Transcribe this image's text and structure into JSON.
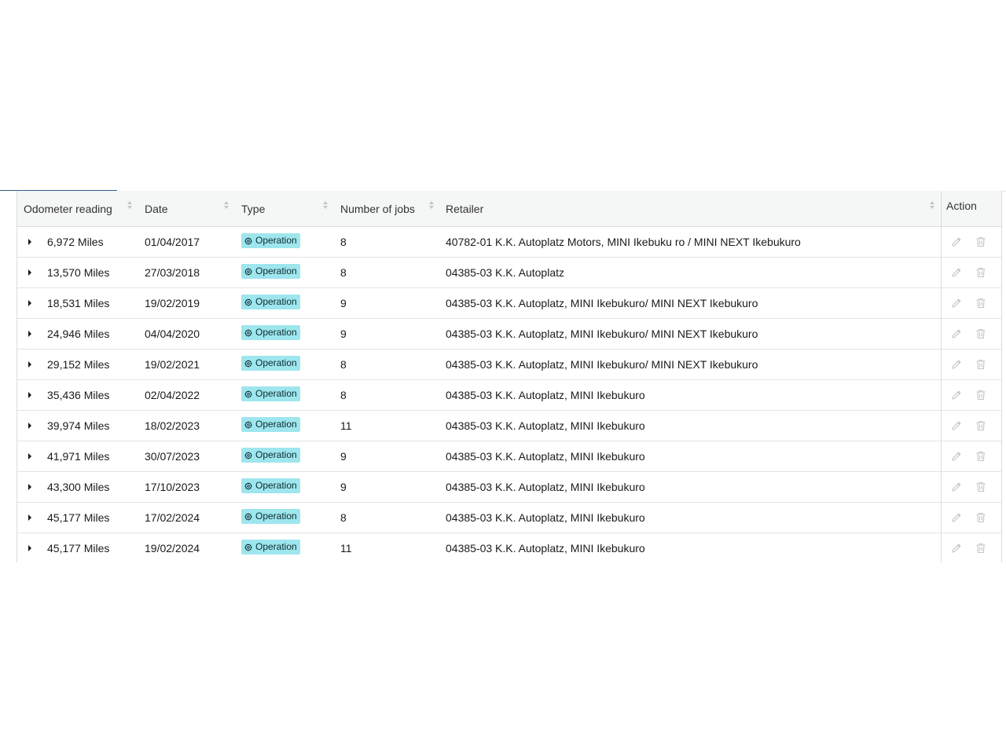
{
  "table": {
    "columns": {
      "odometer": "Odometer reading",
      "date": "Date",
      "type": "Type",
      "jobs": "Number of jobs",
      "retailer": "Retailer",
      "action": "Action"
    },
    "rows": [
      {
        "odometer": "6,972 Miles",
        "date": "01/04/2017",
        "type": "Operation",
        "jobs": "8",
        "retailer": "40782-01 K.K. Autoplatz Motors, MINI Ikebuku ro / MINI NEXT Ikebukuro"
      },
      {
        "odometer": "13,570 Miles",
        "date": "27/03/2018",
        "type": "Operation",
        "jobs": "8",
        "retailer": "04385-03 K.K. Autoplatz"
      },
      {
        "odometer": "18,531 Miles",
        "date": "19/02/2019",
        "type": "Operation",
        "jobs": "9",
        "retailer": "04385-03 K.K. Autoplatz, MINI Ikebukuro/ MINI NEXT Ikebukuro"
      },
      {
        "odometer": "24,946 Miles",
        "date": "04/04/2020",
        "type": "Operation",
        "jobs": "9",
        "retailer": "04385-03 K.K. Autoplatz, MINI Ikebukuro/ MINI NEXT Ikebukuro"
      },
      {
        "odometer": "29,152 Miles",
        "date": "19/02/2021",
        "type": "Operation",
        "jobs": "8",
        "retailer": "04385-03 K.K. Autoplatz, MINI Ikebukuro/ MINI NEXT Ikebukuro"
      },
      {
        "odometer": "35,436 Miles",
        "date": "02/04/2022",
        "type": "Operation",
        "jobs": "8",
        "retailer": "04385-03 K.K. Autoplatz, MINI Ikebukuro"
      },
      {
        "odometer": "39,974 Miles",
        "date": "18/02/2023",
        "type": "Operation",
        "jobs": "11",
        "retailer": "04385-03 K.K. Autoplatz, MINI Ikebukuro"
      },
      {
        "odometer": "41,971 Miles",
        "date": "30/07/2023",
        "type": "Operation",
        "jobs": "9",
        "retailer": "04385-03 K.K. Autoplatz, MINI Ikebukuro"
      },
      {
        "odometer": "43,300 Miles",
        "date": "17/10/2023",
        "type": "Operation",
        "jobs": "9",
        "retailer": "04385-03 K.K. Autoplatz, MINI Ikebukuro"
      },
      {
        "odometer": "45,177 Miles",
        "date": "17/02/2024",
        "type": "Operation",
        "jobs": "8",
        "retailer": "04385-03 K.K. Autoplatz, MINI Ikebukuro"
      },
      {
        "odometer": "45,177 Miles",
        "date": "19/02/2024",
        "type": "Operation",
        "jobs": "11",
        "retailer": "04385-03 K.K. Autoplatz, MINI Ikebukuro"
      }
    ]
  },
  "icons": {
    "expand": "caret-right-icon",
    "type": "gear-icon",
    "edit": "pencil-icon",
    "delete": "trash-icon",
    "sort": "sort-icon"
  },
  "colors": {
    "tag_bg": "#9ee6ee",
    "tab_indicator": "#2a5d86",
    "header_bg": "#f5f6f6",
    "disabled_icon": "#c4c4c4"
  }
}
